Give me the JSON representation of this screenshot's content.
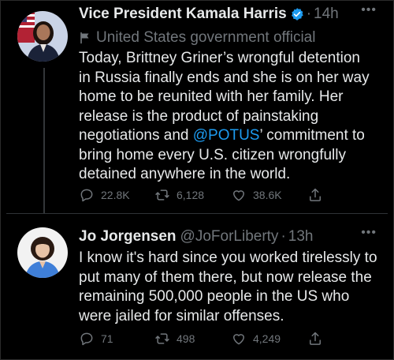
{
  "tweets": [
    {
      "name": "Vice President Kamala Harris",
      "verified": true,
      "time": "14h",
      "affiliation_label": "United States government official",
      "body_lines": [
        "Today, Brittney Griner’s wrongful detention",
        "in Russia finally ends and she is on her way",
        "home to be reunited with her family. Her",
        "release is the product of painstaking",
        "negotiations and ",
        "bring home every U.S. citizen wrongfully",
        "detained anywhere in the world."
      ],
      "mention": "@POTUS",
      "line5_tail": "’ commitment to",
      "replies": "22.8K",
      "retweets": "6,128",
      "likes": "38.6K"
    },
    {
      "name": "Jo Jorgensen",
      "handle": "@JoForLiberty",
      "time": "13h",
      "body_lines": [
        "I know it's hard since you worked tirelessly to",
        "put many of them there, but now release the",
        "remaining 500,000 people in the US who",
        "were jailed for similar offenses."
      ],
      "replies": "71",
      "retweets": "498",
      "likes": "4,249"
    }
  ],
  "more_label": "•••",
  "separator": "·",
  "colors": {
    "background": "#000000",
    "text": "#e7e9ea",
    "muted": "#71767b",
    "accent": "#1d9bf0"
  },
  "icons": [
    "verified-badge-icon",
    "flag-icon",
    "reply-icon",
    "retweet-icon",
    "like-icon",
    "share-icon",
    "more-icon"
  ]
}
